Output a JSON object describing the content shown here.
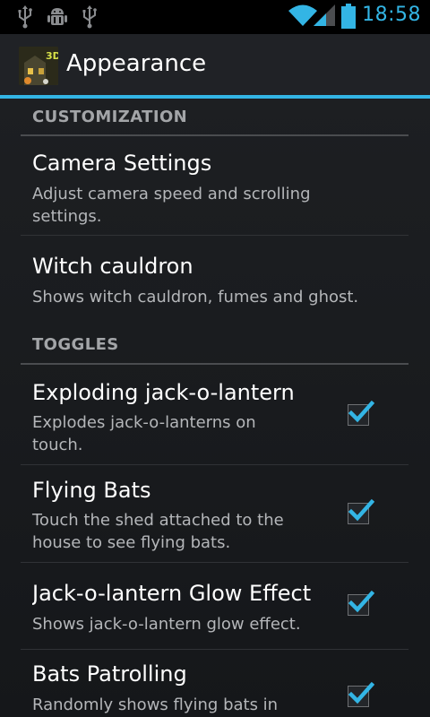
{
  "status_bar": {
    "time": "18:58",
    "icons": [
      "usb-icon",
      "android-debug-icon",
      "usb-icon",
      "wifi-icon",
      "signal-icon",
      "battery-icon"
    ]
  },
  "action_bar": {
    "title": "Appearance",
    "icon": "app-icon"
  },
  "colors": {
    "accent": "#33b5e5",
    "background": "#1a1c1f"
  },
  "sections": [
    {
      "header": "CUSTOMIZATION",
      "items": [
        {
          "title": "Camera Settings",
          "summary": "Adjust camera speed and scrolling settings."
        },
        {
          "title": "Witch cauldron",
          "summary": "Shows witch cauldron, fumes and ghost."
        }
      ]
    },
    {
      "header": "TOGGLES",
      "items": [
        {
          "title": "Exploding jack-o-lantern",
          "summary": "Explodes jack-o-lanterns on touch.",
          "checked": true
        },
        {
          "title": "Flying Bats",
          "summary": "Touch the shed attached to the house to see flying bats.",
          "checked": true
        },
        {
          "title": "Jack-o-lantern Glow Effect",
          "summary": "Shows jack-o-lantern glow effect.",
          "checked": true
        },
        {
          "title": "Bats Patrolling",
          "summary": "Randomly shows flying bats in",
          "checked": true
        }
      ]
    }
  ]
}
